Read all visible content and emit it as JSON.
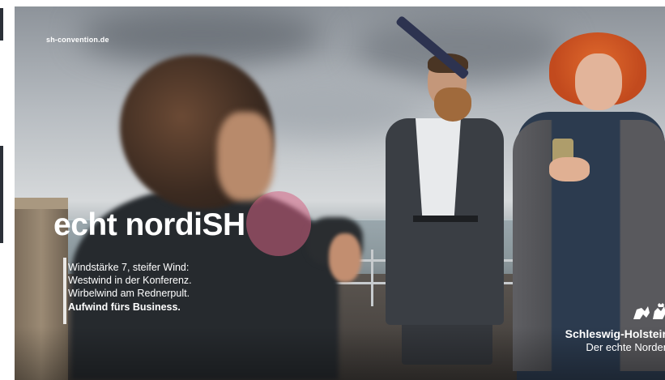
{
  "ad": {
    "url": "sh-convention.de",
    "headline": "echt nordiSH",
    "copy_lines": [
      "Windstärke 7, steifer Wind:",
      "Westwind in der Konferenz.",
      "Wirbelwind am Rednerpult."
    ],
    "copy_emphasis": "Aufwind fürs Business.",
    "logo": {
      "icon": "crest-lion-icon",
      "brand": "Schleswig-Holstein",
      "slogan": "Der echte Norden"
    }
  }
}
